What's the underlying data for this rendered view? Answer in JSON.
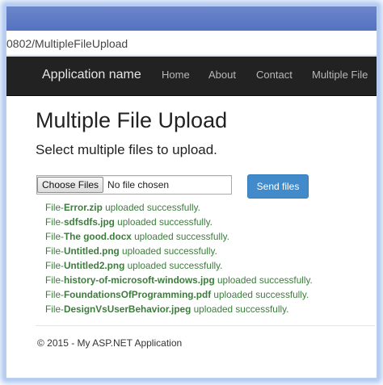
{
  "browser": {
    "url": "0802/MultipleFileUpload"
  },
  "navbar": {
    "brand": "Application name",
    "links": [
      "Home",
      "About",
      "Contact",
      "Multiple File"
    ]
  },
  "main": {
    "title": "Multiple File Upload",
    "subtitle": "Select multiple files to upload.",
    "choose_label": "Choose Files",
    "no_file_text": "No file chosen",
    "send_label": "Send files",
    "results_prefix": "File-",
    "results_suffix": " uploaded successfully.",
    "results": [
      "Error.zip",
      "sdfsdfs.jpg",
      "The good.docx",
      "Untitled.png",
      "Untitled2.png",
      "history-of-microsoft-windows.jpg",
      "FoundationsOfProgramming.pdf",
      "DesignVsUserBehavior.jpeg"
    ]
  },
  "footer": {
    "text": "© 2015 - My ASP.NET Application"
  },
  "colors": {
    "navbar_bg": "#222222",
    "primary_button": "#428bca",
    "success_text": "#3c7d3c"
  }
}
